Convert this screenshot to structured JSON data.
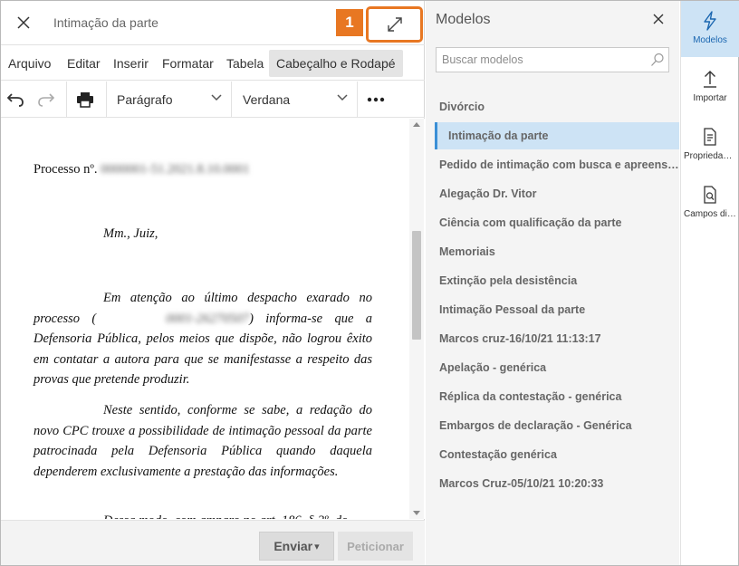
{
  "editor": {
    "title": "Intimação da parte",
    "callout_number": "1",
    "menu": [
      "Arquivo",
      "Editar",
      "Inserir",
      "Formatar",
      "Tabela",
      "Cabeçalho e Rodapé"
    ],
    "toolbar": {
      "paragraph_style": "Parágrafo",
      "font": "Verdana"
    },
    "document": {
      "processo_label": "Processo nº.",
      "processo_number": "0000001-51.2021.8.10.0001",
      "salutation": "Mm., Juiz,",
      "p1_start": "Em atenção ao último despacho exarado no processo (",
      "p1_redacted": "0001-26270507",
      "p1_end": ") informa-se que a Defensoria Pública, pelos meios que dispõe, não logrou êxito em contatar a autora para que se manifestasse a respeito das provas que pretende produzir.",
      "p2": "Neste sentido, conforme se sabe, a redação do novo CPC trouxe a possibilidade de intimação pessoal da parte patrocinada pela Defensoria Pública quando daquela dependerem exclusivamente a prestação das informações.",
      "p3_partial": "Dessa modo, com amparo no art. 186, § 2º, do"
    },
    "footer": {
      "send_label": "Enviar",
      "send_caret": "▾",
      "petition_label": "Peticionar"
    }
  },
  "modelos": {
    "title": "Modelos",
    "search_placeholder": "Buscar modelos",
    "items": [
      {
        "label": "Divórcio",
        "selected": false
      },
      {
        "label": "Intimação da parte",
        "selected": true
      },
      {
        "label": "Pedido de intimação com busca e apreensão de documentos",
        "selected": false
      },
      {
        "label": "Alegação Dr. Vitor",
        "selected": false
      },
      {
        "label": "Ciência com qualificação da parte",
        "selected": false
      },
      {
        "label": "Memoriais",
        "selected": false
      },
      {
        "label": "Extinção pela desistência",
        "selected": false
      },
      {
        "label": "Intimação Pessoal da parte",
        "selected": false
      },
      {
        "label": "Marcos cruz-16/10/21 11:13:17",
        "selected": false
      },
      {
        "label": "Apelação - genérica",
        "selected": false
      },
      {
        "label": "Réplica da contestação - genérica",
        "selected": false
      },
      {
        "label": "Embargos de declaração - Genérica",
        "selected": false
      },
      {
        "label": "Contestação genérica",
        "selected": false
      },
      {
        "label": "Marcos Cruz-05/10/21 10:20:33",
        "selected": false
      }
    ]
  },
  "rail": [
    {
      "label": "Modelos",
      "icon": "lightning-icon",
      "active": true
    },
    {
      "label": "Importar",
      "icon": "upload-icon",
      "active": false
    },
    {
      "label": "Propriedades",
      "icon": "document-properties-icon",
      "active": false
    },
    {
      "label": "Campos dinâmicos",
      "icon": "document-search-icon",
      "active": false
    }
  ],
  "colors": {
    "accent_blue": "#3b8fd6",
    "selected_bg": "#cde3f5",
    "callout_orange": "#e87722"
  }
}
